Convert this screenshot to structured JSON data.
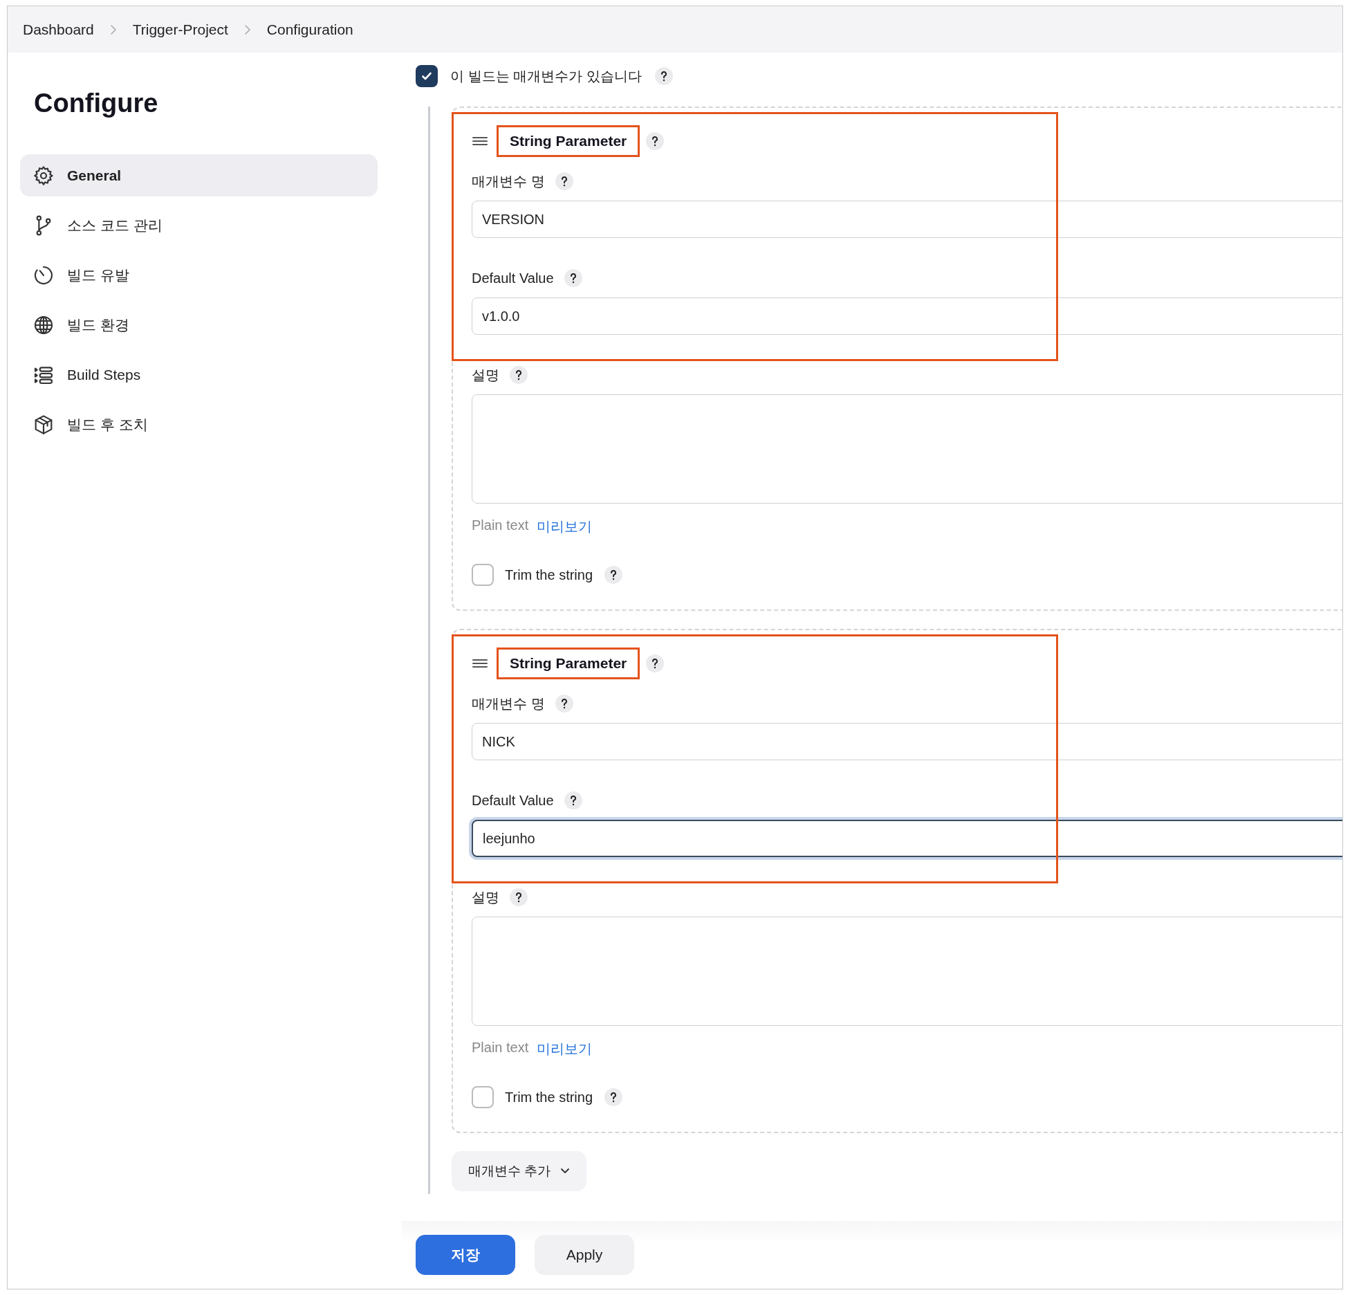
{
  "breadcrumb": [
    {
      "label": "Dashboard"
    },
    {
      "label": "Trigger-Project"
    },
    {
      "label": "Configuration"
    }
  ],
  "sidebar": {
    "title": "Configure",
    "items": [
      {
        "label": "General",
        "selected": true
      },
      {
        "label": "소스 코드 관리",
        "selected": false
      },
      {
        "label": "빌드 유발",
        "selected": false
      },
      {
        "label": "빌드 환경",
        "selected": false
      },
      {
        "label": "Build Steps",
        "selected": false
      },
      {
        "label": "빌드 후 조치",
        "selected": false
      }
    ]
  },
  "has_parameters": {
    "label": "이 빌드는 매개변수가 있습니다",
    "checked": true
  },
  "parameters": [
    {
      "title": "String Parameter",
      "highlighted": true,
      "title_highlighted": true,
      "fields": [
        {
          "label": "매개변수 명",
          "value": "VERSION",
          "focused": false
        },
        {
          "label": "Default Value",
          "value": "v1.0.0",
          "focused": false
        }
      ],
      "description": {
        "label": "설명"
      },
      "format_note": "Plain text",
      "preview_link": "미리보기",
      "trim": {
        "label": "Trim the string",
        "checked": false
      }
    },
    {
      "title": "String Parameter",
      "highlighted": true,
      "title_highlighted": true,
      "fields": [
        {
          "label": "매개변수 명",
          "value": "NICK",
          "focused": false
        },
        {
          "label": "Default Value",
          "value": "leejunho",
          "focused": true
        }
      ],
      "description": {
        "label": "설명"
      },
      "format_note": "Plain text",
      "preview_link": "미리보기",
      "trim": {
        "label": "Trim the string",
        "checked": false
      }
    }
  ],
  "add_button": {
    "label": "매개변수 추가"
  },
  "buttons": [
    {
      "label": "저장",
      "kind": "primary"
    },
    {
      "label": "Apply",
      "kind": "secondary"
    }
  ]
}
